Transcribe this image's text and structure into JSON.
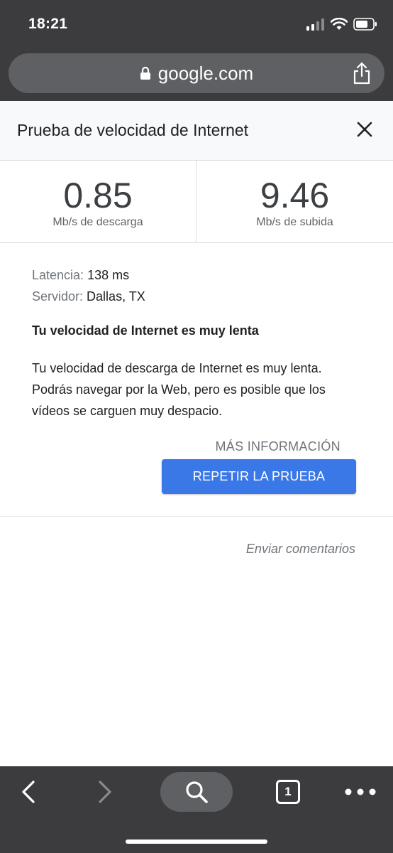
{
  "status_bar": {
    "time": "18:21"
  },
  "browser": {
    "url": "google.com"
  },
  "card": {
    "title": "Prueba de velocidad de Internet",
    "download": {
      "value": "0.85",
      "unit": "Mb/s de descarga"
    },
    "upload": {
      "value": "9.46",
      "unit": "Mb/s de subida"
    },
    "latency": {
      "label": "Latencia:",
      "value": "138 ms"
    },
    "server": {
      "label": "Servidor:",
      "value": "Dallas, TX"
    },
    "verdict": "Tu velocidad de Internet es muy lenta",
    "description": "Tu velocidad de descarga de Internet es muy lenta. Podrás navegar por la Web, pero es posible que los vídeos se carguen muy despacio.",
    "more_info": "MÁS INFORMACIÓN",
    "repeat_button": "REPETIR LA PRUEBA",
    "feedback": "Enviar comentarios"
  },
  "toolbar": {
    "tab_count": "1"
  },
  "colors": {
    "chrome": "#3c3c3e",
    "url_bar": "#5f6063",
    "primary_button": "#3b78e7"
  }
}
